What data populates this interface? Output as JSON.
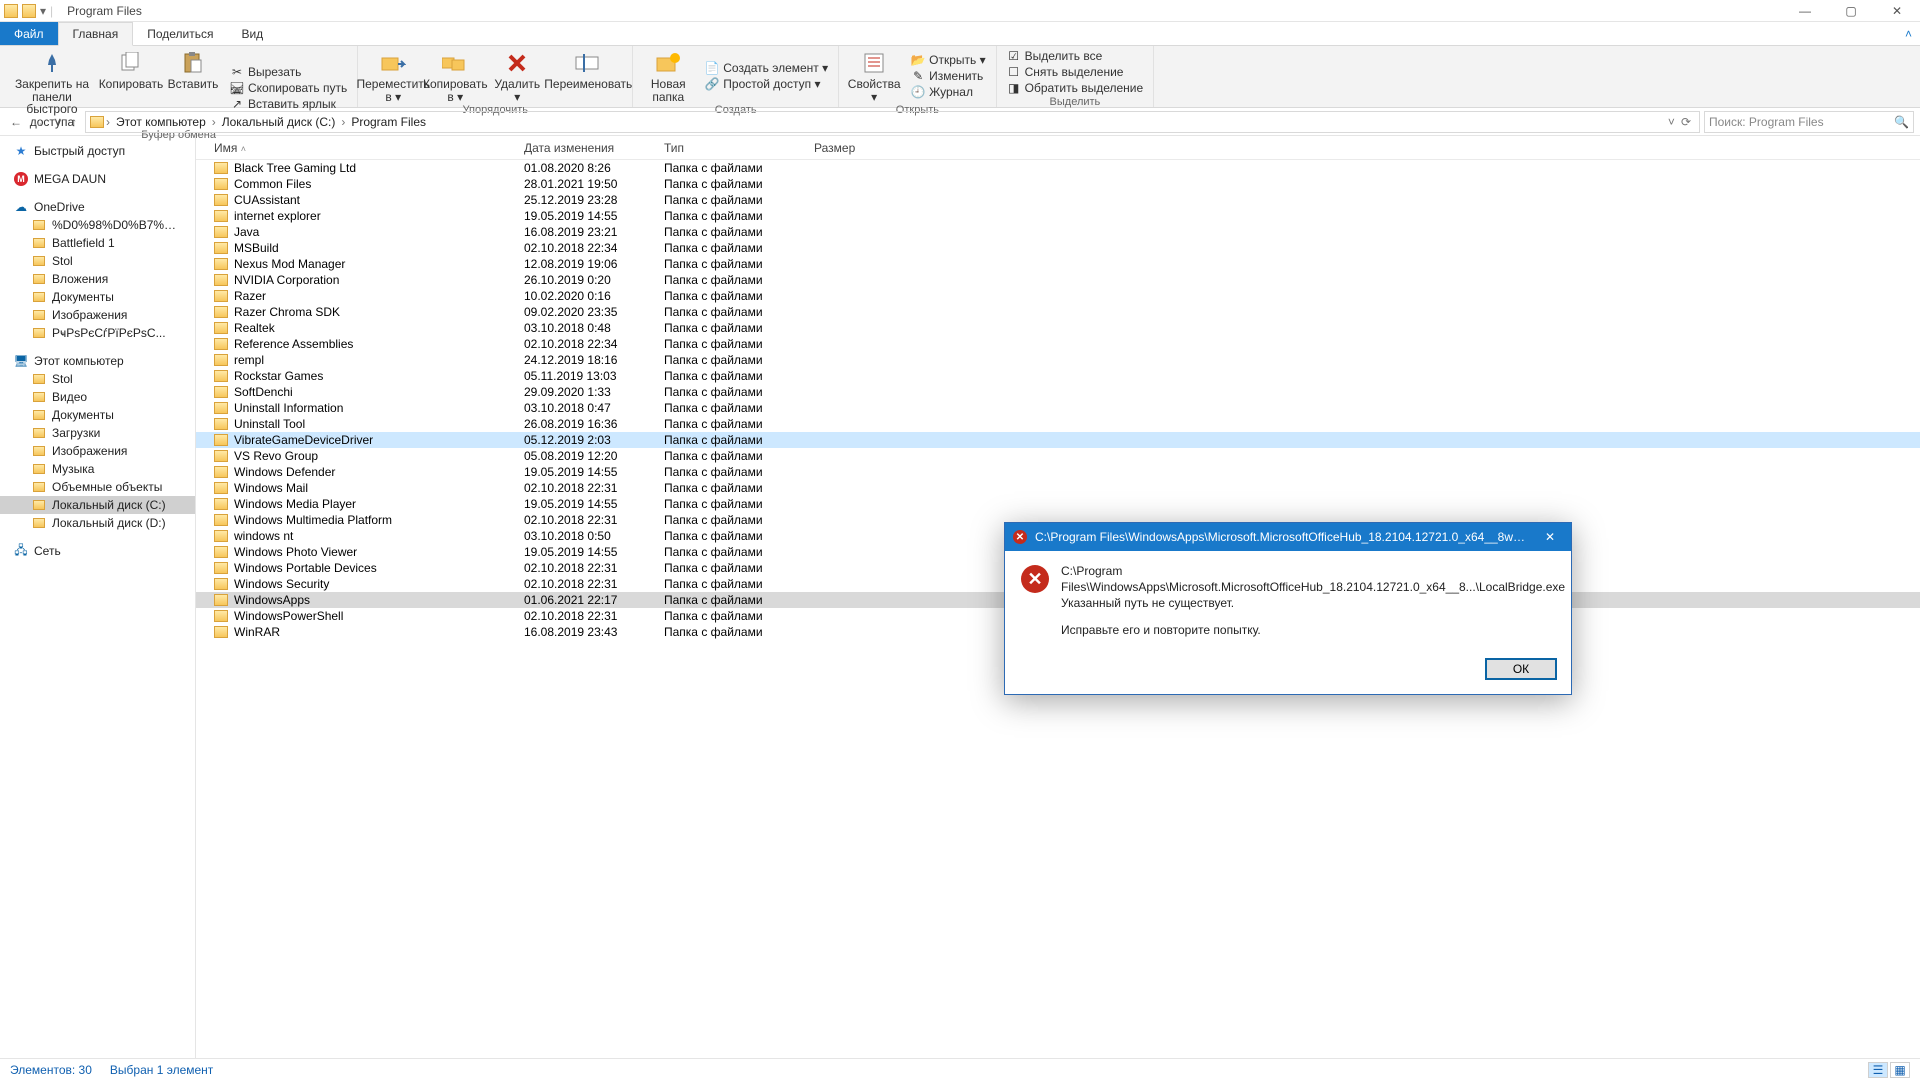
{
  "window": {
    "title": "Program Files"
  },
  "tabs": {
    "file": "Файл",
    "home": "Главная",
    "share": "Поделиться",
    "view": "Вид"
  },
  "qat": {
    "save_disabled": true
  },
  "ribbon": {
    "clipboard": {
      "pin": "Закрепить на панели быстрого доступа",
      "copy": "Копировать",
      "paste": "Вставить",
      "cut": "Вырезать",
      "copy_path": "Скопировать путь",
      "paste_shortcut": "Вставить ярлык",
      "label": "Буфер обмена"
    },
    "organize": {
      "move_to": "Переместить в ▾",
      "copy_to": "Копировать в ▾",
      "delete": "Удалить ▾",
      "rename": "Переименовать",
      "label": "Упорядочить"
    },
    "new": {
      "new_folder": "Новая папка",
      "new_item": "Создать элемент ▾",
      "easy_access": "Простой доступ ▾",
      "label": "Создать"
    },
    "open": {
      "properties": "Свойства ▾",
      "open": "Открыть ▾",
      "edit": "Изменить",
      "history": "Журнал",
      "label": "Открыть"
    },
    "select": {
      "select_all": "Выделить все",
      "select_none": "Снять выделение",
      "invert": "Обратить выделение",
      "label": "Выделить"
    }
  },
  "breadcrumbs": [
    "Этот компьютер",
    "Локальный диск (C:)",
    "Program Files"
  ],
  "search_placeholder": "Поиск: Program Files",
  "columns": {
    "name": "Имя",
    "date": "Дата изменения",
    "type": "Тип",
    "size": "Размер"
  },
  "sidebar": {
    "quick": "Быстрый доступ",
    "mega": "MEGA DAUN",
    "onedrive": "OneDrive",
    "onedrive_children": [
      "%D0%98%D0%B7%…",
      "Battlefield 1",
      "Stol",
      "Вложения",
      "Документы",
      "Изображения",
      "РҹРѕРєСѓРїРєРѕС..."
    ],
    "thispc": "Этот компьютер",
    "thispc_children": [
      "Stol",
      "Видео",
      "Документы",
      "Загрузки",
      "Изображения",
      "Музыка",
      "Объемные объекты",
      "Локальный диск (C:)",
      "Локальный диск (D:)"
    ],
    "network": "Сеть"
  },
  "rows": [
    {
      "name": "Black Tree Gaming Ltd",
      "date": "01.08.2020 8:26",
      "type": "Папка с файлами"
    },
    {
      "name": "Common Files",
      "date": "28.01.2021 19:50",
      "type": "Папка с файлами"
    },
    {
      "name": "CUAssistant",
      "date": "25.12.2019 23:28",
      "type": "Папка с файлами"
    },
    {
      "name": "internet explorer",
      "date": "19.05.2019 14:55",
      "type": "Папка с файлами"
    },
    {
      "name": "Java",
      "date": "16.08.2019 23:21",
      "type": "Папка с файлами"
    },
    {
      "name": "MSBuild",
      "date": "02.10.2018 22:34",
      "type": "Папка с файлами"
    },
    {
      "name": "Nexus Mod Manager",
      "date": "12.08.2019 19:06",
      "type": "Папка с файлами"
    },
    {
      "name": "NVIDIA Corporation",
      "date": "26.10.2019 0:20",
      "type": "Папка с файлами"
    },
    {
      "name": "Razer",
      "date": "10.02.2020 0:16",
      "type": "Папка с файлами"
    },
    {
      "name": "Razer Chroma SDK",
      "date": "09.02.2020 23:35",
      "type": "Папка с файлами"
    },
    {
      "name": "Realtek",
      "date": "03.10.2018 0:48",
      "type": "Папка с файлами"
    },
    {
      "name": "Reference Assemblies",
      "date": "02.10.2018 22:34",
      "type": "Папка с файлами"
    },
    {
      "name": "rempl",
      "date": "24.12.2019 18:16",
      "type": "Папка с файлами"
    },
    {
      "name": "Rockstar Games",
      "date": "05.11.2019 13:03",
      "type": "Папка с файлами"
    },
    {
      "name": "SoftDenchi",
      "date": "29.09.2020 1:33",
      "type": "Папка с файлами"
    },
    {
      "name": "Uninstall Information",
      "date": "03.10.2018 0:47",
      "type": "Папка с файлами"
    },
    {
      "name": "Uninstall Tool",
      "date": "26.08.2019 16:36",
      "type": "Папка с файлами"
    },
    {
      "name": "VibrateGameDeviceDriver",
      "date": "05.12.2019 2:03",
      "type": "Папка с файлами",
      "highlight": true
    },
    {
      "name": "VS Revo Group",
      "date": "05.08.2019 12:20",
      "type": "Папка с файлами"
    },
    {
      "name": "Windows Defender",
      "date": "19.05.2019 14:55",
      "type": "Папка с файлами"
    },
    {
      "name": "Windows Mail",
      "date": "02.10.2018 22:31",
      "type": "Папка с файлами"
    },
    {
      "name": "Windows Media Player",
      "date": "19.05.2019 14:55",
      "type": "Папка с файлами"
    },
    {
      "name": "Windows Multimedia Platform",
      "date": "02.10.2018 22:31",
      "type": "Папка с файлами"
    },
    {
      "name": "windows nt",
      "date": "03.10.2018 0:50",
      "type": "Папка с файлами"
    },
    {
      "name": "Windows Photo Viewer",
      "date": "19.05.2019 14:55",
      "type": "Папка с файлами"
    },
    {
      "name": "Windows Portable Devices",
      "date": "02.10.2018 22:31",
      "type": "Папка с файлами"
    },
    {
      "name": "Windows Security",
      "date": "02.10.2018 22:31",
      "type": "Папка с файлами"
    },
    {
      "name": "WindowsApps",
      "date": "01.06.2021 22:17",
      "type": "Папка с файлами",
      "selected": true
    },
    {
      "name": "WindowsPowerShell",
      "date": "02.10.2018 22:31",
      "type": "Папка с файлами"
    },
    {
      "name": "WinRAR",
      "date": "16.08.2019 23:43",
      "type": "Папка с файлами"
    }
  ],
  "status": {
    "count": "Элементов: 30",
    "selected": "Выбран 1 элемент"
  },
  "dialog": {
    "title": "C:\\Program Files\\WindowsApps\\Microsoft.MicrosoftOfficeHub_18.2104.12721.0_x64__8weky...",
    "line1": "C:\\Program Files\\WindowsApps\\Microsoft.MicrosoftOfficeHub_18.2104.12721.0_x64__8...\\LocalBridge.exe",
    "line2": "Указанный путь не существует.",
    "line3": "Исправьте его и повторите попытку.",
    "ok": "ОК"
  }
}
